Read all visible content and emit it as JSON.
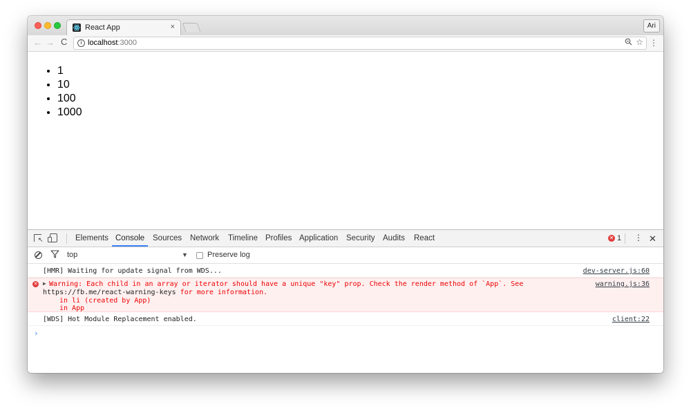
{
  "browser": {
    "tab_title": "React App",
    "tab_close": "×",
    "profile": "Ari",
    "url_host": "localhost",
    "url_port": ":3000",
    "nav_back": "←",
    "nav_forward": "→",
    "nav_reload": "C",
    "zoom_glyph": "🔍",
    "star_glyph": "☆",
    "menu_glyph": "⋮"
  },
  "page": {
    "list_items": [
      "1",
      "10",
      "100",
      "1000"
    ]
  },
  "devtools": {
    "tabs": [
      "Elements",
      "Console",
      "Sources",
      "Network",
      "Timeline",
      "Profiles",
      "Application",
      "Security",
      "Audits",
      "React"
    ],
    "active_tab": "Console",
    "error_count": "1",
    "more_glyph": "⋮",
    "close_glyph": "✕",
    "filter": {
      "context": "top",
      "context_arrow": "▼",
      "preserve_log": "Preserve log"
    },
    "console": {
      "messages": [
        {
          "type": "log",
          "text": "[HMR] Waiting for update signal from WDS...",
          "source": "dev-server.js:60"
        },
        {
          "type": "error",
          "line1": "Warning: Each child in an array or iterator should have a unique \"key\" prop. Check the render method of `App`. See",
          "line2_link": "https://fb.me/react-warning-keys",
          "line2_rest": " for more information.",
          "line3": "in li (created by App)",
          "line4": "in App",
          "source": "warning.js:36"
        },
        {
          "type": "log",
          "text": "[WDS] Hot Module Replacement enabled.",
          "source": "client:22"
        }
      ],
      "prompt": "›"
    }
  },
  "colors": {
    "accent": "#3e82f7",
    "error": "#e00000",
    "error_bg": "#fff0f0"
  }
}
